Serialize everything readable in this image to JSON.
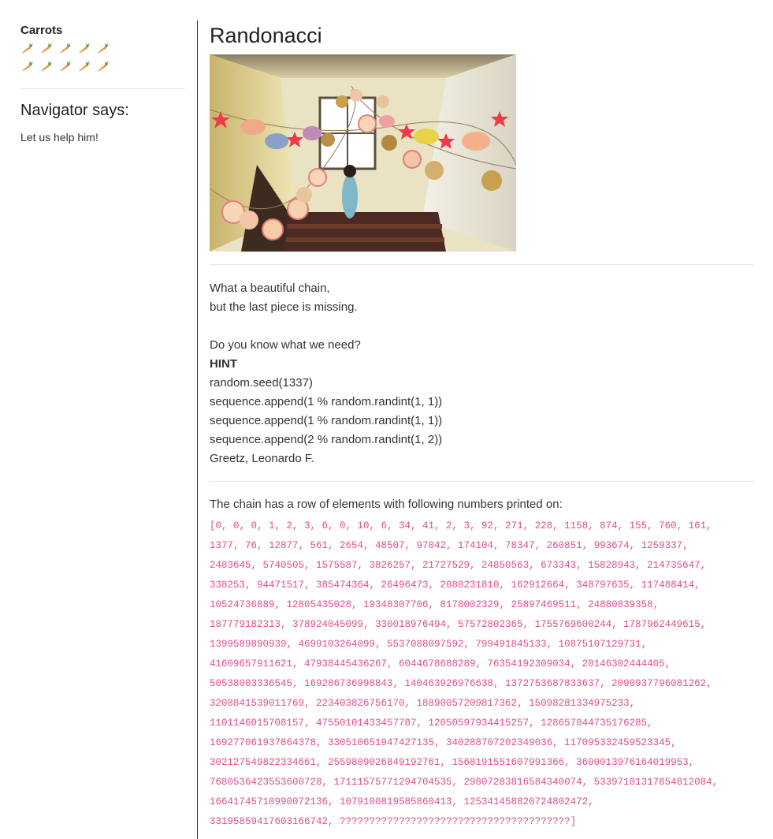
{
  "sidebar": {
    "carrots_title": "Carrots",
    "carrot_count": 10,
    "carrot_icon": "carrot-icon",
    "navigator_title": "Navigator says:",
    "navigator_text": "Let us help him!"
  },
  "main": {
    "title": "Randonacci",
    "photo_icon": "photo-of-paper-garland-chain-in-stairwell",
    "story_lines": [
      "What a beautiful chain,",
      "but the last piece is missing.",
      "",
      "Do you know what we need?",
      "HINT",
      "random.seed(1337)",
      "sequence.append(1 % random.randint(1, 1))",
      "sequence.append(1 % random.randint(1, 1))",
      "sequence.append(2 % random.randint(1, 2))",
      "Greetz, Leonardo F."
    ],
    "chain_intro": "The chain has a row of elements with following numbers printed on:",
    "chain_lines": [
      "[0, 0, 0, 1, 2, 3, 6, 0, 10, 6, 34, 41, 2, 3, 92, 271, 228, 1158, 874, 155, 760, 161,",
      "1377, 76, 12877, 561, 2654, 48507, 97042, 174104, 78347, 260851, 993674, 1259337,",
      "2483645, 5740505, 1575587, 3826257, 21727529, 24850563, 673343, 15828943, 214735647,",
      "338253, 94471517, 385474364, 26496473, 2080231810, 162912664, 348797635, 117488414,",
      "10524736889, 12805435028, 19348307706, 8178002329, 25897469511, 24880839358,",
      "187779182313, 378924045099, 330018976494, 57572802365, 1755769600244, 1787962449615,",
      "1399589890939, 4699103264099, 5537088097592, 799491845133, 10875107129731,",
      "41609657911621, 47938445436267, 6044678688289, 76354192309034, 20146302444405,",
      "50538003336545, 169286736998843, 140463926976638, 1372753687833637, 2090937796081262,",
      "3208841539011769, 223403826756170, 18890057209817362, 15098281334975233,",
      "1101146015708157, 47550101433457787, 12050597934415257, 128657844735176285,",
      "169277061937864378, 330510651947427135, 340288707202349036, 117095332459523345,",
      "302127549822334661, 2559809026849192761, 1568191551607991366, 3600013976164019953,",
      "7680536423553600728, 17111575771294704535, 29807283816584340074, 53397101317854812084,",
      "16641745710990072136, 107910081958586041​3, 125341458820724802472,",
      "33195859417603166742, ???????????????????????????????????????]"
    ]
  }
}
